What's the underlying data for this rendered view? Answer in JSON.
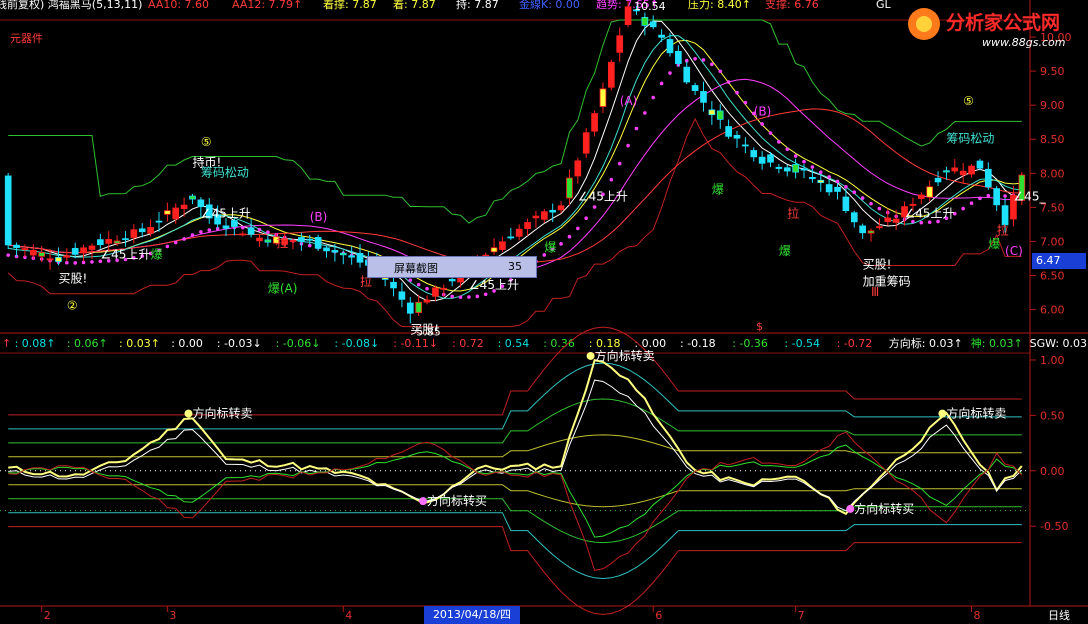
{
  "header": {
    "title": "钱前复权) 鸿福黑马(5,13,11)",
    "items": [
      {
        "label": "AA10:",
        "value": "7.60",
        "color": "#ff3b3b"
      },
      {
        "label": "AA12:",
        "value": "7.79↑",
        "color": "#ff3b3b"
      },
      {
        "label": "着撑:",
        "value": "7.87",
        "color": "#ffff40"
      },
      {
        "label": "着:",
        "value": "7.87",
        "color": "#ffff40"
      },
      {
        "label": "持:",
        "value": "7.87",
        "color": "#ffffff"
      },
      {
        "label": "金線K:",
        "value": "0.00",
        "color": "#4060ff"
      },
      {
        "label": "趋势:",
        "value": "7.65↑",
        "color": "#ff40ff"
      },
      {
        "label": "压力:",
        "value": "8.40↑",
        "color": "#ffff40"
      },
      {
        "label": "支撑:",
        "value": "6.76",
        "color": "#ff3b3b"
      }
    ],
    "sub_label": "元器件",
    "gl_label": "GL"
  },
  "logo": {
    "text": "分析家公式网",
    "url_text": "www.88gs.com"
  },
  "popup": {
    "label": "屏幕截图",
    "value": "35"
  },
  "price_tag": "6.47",
  "date_tag": "2013/04/18/四",
  "period_label": "日线",
  "mid_marker": "$",
  "indicator_header": [
    {
      "text": "↑",
      "color": "#ff3b3b"
    },
    {
      "text": ": 0.08↑",
      "color": "#00e0e0"
    },
    {
      "text": ": 0.06↑",
      "color": "#30e030"
    },
    {
      "text": ": 0.03↑",
      "color": "#ffff40"
    },
    {
      "text": ": 0.00",
      "color": "#ffffff"
    },
    {
      "text": ": -0.03↓",
      "color": "#ffffff"
    },
    {
      "text": ": -0.06↓",
      "color": "#30e030"
    },
    {
      "text": ": -0.08↓",
      "color": "#00e0e0"
    },
    {
      "text": ": -0.11↓",
      "color": "#ff3b3b"
    },
    {
      "text": ": 0.72",
      "color": "#ff3b3b"
    },
    {
      "text": ": 0.54",
      "color": "#00e0e0"
    },
    {
      "text": ": 0.36",
      "color": "#30e030"
    },
    {
      "text": ": 0.18",
      "color": "#ffff40"
    },
    {
      "text": ": 0.00",
      "color": "#ffffff"
    },
    {
      "text": ": -0.18",
      "color": "#ffffff"
    },
    {
      "text": ": -0.36",
      "color": "#30e030"
    },
    {
      "text": ": -0.54",
      "color": "#00e0e0"
    },
    {
      "text": ": -0.72",
      "color": "#ff3b3b"
    },
    {
      "text": "方向标: 0.03↑",
      "color": "#ffffff"
    },
    {
      "text": "神: 0.03↑",
      "color": "#30e030"
    },
    {
      "text": "SGW: 0.03↑",
      "color": "#ffffff"
    }
  ],
  "chart_data": [
    {
      "type": "candlestick",
      "title": "",
      "y_ticks": [
        6.0,
        6.5,
        7.0,
        7.5,
        8.0,
        8.5,
        9.0,
        9.5,
        10.0
      ],
      "ylim": [
        5.7,
        10.25
      ],
      "x_ticks": [
        "2",
        "3",
        "4",
        "5",
        "6",
        "7",
        "8"
      ],
      "x_tick_index": [
        4,
        19,
        40,
        56,
        77,
        94,
        115
      ],
      "bar_count": 122,
      "high_label": "10.54",
      "low_label": "5.85",
      "annotations": [
        {
          "text": "持币!",
          "i": 22,
          "y": 8.1,
          "color": "#ffffff"
        },
        {
          "text": "筹码松动",
          "i": 23,
          "y": 7.95,
          "color": "#40e0d0"
        },
        {
          "text": "∠45上升",
          "i": 23,
          "y": 7.35,
          "color": "#ffffff"
        },
        {
          "text": "∠45上升",
          "i": 11,
          "y": 6.75,
          "color": "#ffffff"
        },
        {
          "text": "买股!",
          "i": 6,
          "y": 6.4,
          "color": "#ffffff"
        },
        {
          "text": "爆",
          "i": 17,
          "y": 6.75,
          "color": "#30e030"
        },
        {
          "text": "拉",
          "i": 32,
          "y": 6.92,
          "color": "#ff3b3b"
        },
        {
          "text": "爆(A)",
          "i": 31,
          "y": 6.25,
          "color": "#30e030"
        },
        {
          "text": "拉",
          "i": 42,
          "y": 6.35,
          "color": "#ff3b3b"
        },
        {
          "text": "∠45上升",
          "i": 55,
          "y": 6.3,
          "color": "#ffffff"
        },
        {
          "text": "∠45上升",
          "i": 68,
          "y": 7.6,
          "color": "#ffffff"
        },
        {
          "text": "爆",
          "i": 64,
          "y": 6.85,
          "color": "#30e030"
        },
        {
          "text": "买股!",
          "i": 48,
          "y": 5.65,
          "color": "#ffffff"
        },
        {
          "text": "(A)",
          "i": 73,
          "y": 9.0,
          "color": "#ff40ff"
        },
        {
          "text": "(B)",
          "i": 36,
          "y": 7.3,
          "color": "#ff40ff"
        },
        {
          "text": "(B)",
          "i": 89,
          "y": 8.85,
          "color": "#ff40ff"
        },
        {
          "text": "爆",
          "i": 84,
          "y": 7.7,
          "color": "#30e030"
        },
        {
          "text": "拉",
          "i": 93,
          "y": 7.35,
          "color": "#ff3b3b"
        },
        {
          "text": "爆",
          "i": 92,
          "y": 6.8,
          "color": "#30e030"
        },
        {
          "text": "买股!",
          "i": 102,
          "y": 6.6,
          "color": "#ffffff"
        },
        {
          "text": "加重筹码",
          "i": 102,
          "y": 6.35,
          "color": "#ffffff"
        },
        {
          "text": "∠45上升",
          "i": 107,
          "y": 7.35,
          "color": "#ffffff"
        },
        {
          "text": "筹码松动",
          "i": 112,
          "y": 8.45,
          "color": "#40e0d0"
        },
        {
          "text": "∠45_",
          "i": 120,
          "y": 7.6,
          "color": "#ffffff"
        },
        {
          "text": "爆",
          "i": 117,
          "y": 6.9,
          "color": "#30e030"
        },
        {
          "text": "拉",
          "i": 118,
          "y": 7.1,
          "color": "#ff3b3b"
        },
        {
          "text": "(C)",
          "i": 119,
          "y": 6.8,
          "color": "#ff40ff"
        },
        {
          "text": "⑤",
          "i": 23,
          "y": 8.4,
          "color": "#ffff40"
        },
        {
          "text": "⑤",
          "i": 114,
          "y": 9.0,
          "color": "#ffff40"
        },
        {
          "text": "②",
          "i": 7,
          "y": 6.0,
          "color": "#ffff40"
        },
        {
          "text": "Ⅲ",
          "i": 103,
          "y": 6.2,
          "color": "#ff3b3b"
        }
      ]
    },
    {
      "type": "line",
      "title": "",
      "y_ticks": [
        -0.5,
        0.0,
        0.5,
        1.0
      ],
      "ylim": [
        -1.22,
        1.18
      ],
      "x_ticks": [
        "2",
        "3",
        "4",
        "5",
        "6",
        "7",
        "8"
      ],
      "annotations": [
        {
          "text": "方向标转卖",
          "i": 22,
          "y": 0.48,
          "color": "#ffffff"
        },
        {
          "text": "方向标转卖",
          "i": 70,
          "y": 1.0,
          "color": "#ffffff"
        },
        {
          "text": "方向标转卖",
          "i": 112,
          "y": 0.48,
          "color": "#ffffff"
        },
        {
          "text": "方向标转买",
          "i": 50,
          "y": -0.31,
          "color": "#ffffff"
        },
        {
          "text": "方向标转买",
          "i": 101,
          "y": -0.38,
          "color": "#ffffff"
        }
      ]
    }
  ]
}
